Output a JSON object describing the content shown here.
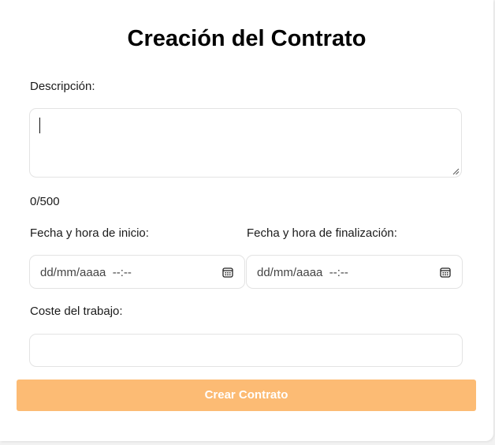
{
  "form": {
    "title": "Creación del Contrato",
    "description": {
      "label": "Descripción:",
      "value": "",
      "counter": "0/500"
    },
    "start": {
      "label": "Fecha y hora de inicio:",
      "placeholder": "dd/mm/aaaa  --:--",
      "icon": "calendar-icon"
    },
    "end": {
      "label": "Fecha y hora de finalización:",
      "placeholder": "dd/mm/aaaa  --:--",
      "icon": "calendar-icon"
    },
    "cost": {
      "label": "Coste del trabajo:",
      "value": ""
    },
    "submit_label": "Crear Contrato",
    "colors": {
      "button_bg": "#fcbb74",
      "button_text": "#ffffff",
      "border": "#e3e3e3"
    }
  }
}
